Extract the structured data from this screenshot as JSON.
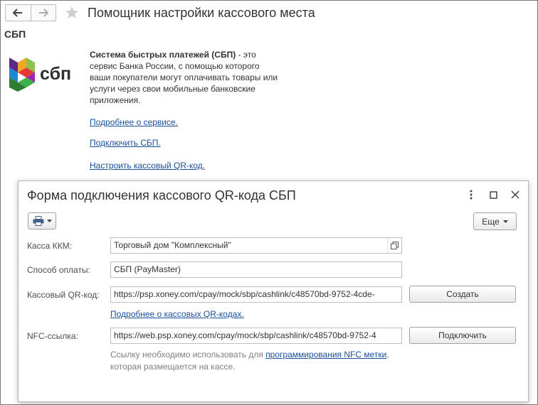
{
  "header": {
    "title": "Помощник настройки кассового места"
  },
  "section": {
    "title": "СБП"
  },
  "logo": {
    "text": "сбп"
  },
  "description": {
    "bold": "Система быстрых платежей (СБП)",
    "rest": " - это сервис Банка России, с помощью которого ваши покупатели могут оплачивать товары или услуги через свои мобильные банковские приложения."
  },
  "links": {
    "more_about": "Подробнее о сервисе.",
    "connect": "Подключить СБП.",
    "setup_qr": "Настроить кассовый QR-код."
  },
  "dialog": {
    "title": "Форма подключения кассового QR-кода СБП",
    "more_label": "Еще",
    "fields": {
      "kkm_label": "Касса ККМ:",
      "kkm_value": "Торговый дом \"Комплексный\"",
      "payment_label": "Способ оплаты:",
      "payment_value": "СБП (PayMaster)",
      "qr_label": "Кассовый QR-код:",
      "qr_value": "https://psp.xoney.com/cpay/mock/sbp/cashlink/c48570bd-9752-4cde-",
      "nfc_label": "NFC-ссылка:",
      "nfc_value": "https://web.psp.xoney.com/cpay/mock/sbp/cashlink/c48570bd-9752-4"
    },
    "create_label": "Создать",
    "connect_label": "Подключить",
    "qr_more_link": "Подробнее о кассовых QR-кодах.",
    "hint_before": "Ссылку необходимо использовать для ",
    "hint_link": "программирования NFC метки",
    "hint_after": ", которая размещается на кассе."
  },
  "colors": {
    "link": "#1a4f9c",
    "logo_green": "#3fb14a",
    "logo_purple": "#5b2a86",
    "logo_orange": "#f5a623",
    "logo_blue": "#1e88d3",
    "logo_red": "#e53935"
  },
  "icons": {
    "back": "back-arrow-icon",
    "forward": "forward-arrow-icon",
    "favorite": "star-icon",
    "print": "printer-icon",
    "open": "open-icon",
    "menu": "kebab-menu-icon",
    "maximize": "maximize-icon",
    "close": "close-icon"
  }
}
